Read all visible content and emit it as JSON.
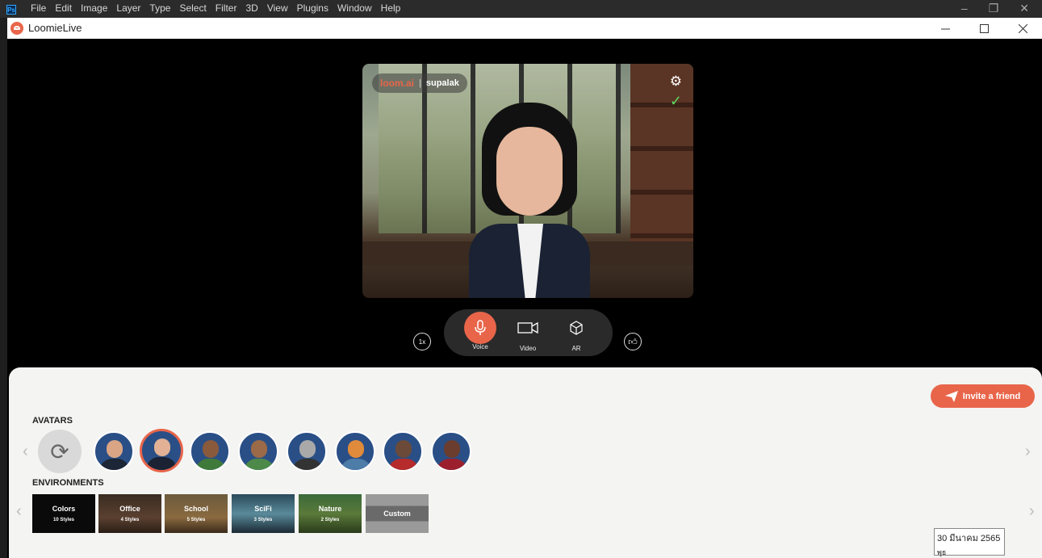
{
  "photoshop": {
    "logo": "Ps",
    "menu": [
      "File",
      "Edit",
      "Image",
      "Layer",
      "Type",
      "Select",
      "Filter",
      "3D",
      "View",
      "Plugins",
      "Window",
      "Help"
    ]
  },
  "app": {
    "title": "LoomieLive"
  },
  "video": {
    "brand": "loom.ai",
    "username": "supalak",
    "settings_icon": "gear-icon",
    "status_icon": "check-icon"
  },
  "controls": {
    "speed": "1x",
    "voice": "Voice",
    "video": "Video",
    "ar": "AR"
  },
  "invite_label": "Invite a friend",
  "avatars": {
    "title": "AVATARS",
    "items": [
      {
        "id": "avatar-1",
        "selected": false
      },
      {
        "id": "avatar-2",
        "selected": true
      },
      {
        "id": "avatar-3",
        "selected": false
      },
      {
        "id": "avatar-4",
        "selected": false
      },
      {
        "id": "avatar-5",
        "selected": false
      },
      {
        "id": "avatar-6",
        "selected": false
      },
      {
        "id": "avatar-7",
        "selected": false
      },
      {
        "id": "avatar-8",
        "selected": false
      }
    ]
  },
  "environments": {
    "title": "ENVIRONMENTS",
    "items": [
      {
        "name": "Colors",
        "styles": "10 Styles"
      },
      {
        "name": "Office",
        "styles": "4 Styles"
      },
      {
        "name": "School",
        "styles": "5 Styles"
      },
      {
        "name": "SciFi",
        "styles": "3 Styles"
      },
      {
        "name": "Nature",
        "styles": "2 Styles"
      },
      {
        "name": "Custom",
        "styles": ""
      }
    ]
  },
  "tooltip": {
    "date": "30 มีนาคม 2565",
    "day": "พุธ"
  },
  "colors": {
    "accent": "#e8654a",
    "panel": "#f4f4f2"
  }
}
